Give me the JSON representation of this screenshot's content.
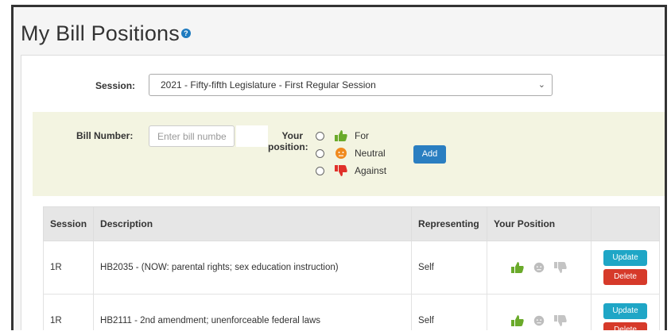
{
  "page": {
    "title": "My Bill Positions",
    "help_icon": "question-icon"
  },
  "session": {
    "label": "Session:",
    "selected": "2021 - Fifty-fifth Legislature - First Regular Session"
  },
  "add_form": {
    "bill_label": "Bill Number:",
    "bill_placeholder": "Enter bill numbe",
    "position_label_line1": "Your",
    "position_label_line2": "position:",
    "options": [
      {
        "label": "For",
        "icon": "thumbs-up-icon",
        "color": "#6aaa2a"
      },
      {
        "label": "Neutral",
        "icon": "neutral-face-icon",
        "color": "#f08a1e"
      },
      {
        "label": "Against",
        "icon": "thumbs-down-icon",
        "color": "#e0302a"
      }
    ],
    "add_label": "Add"
  },
  "table": {
    "headers": [
      "Session",
      "Description",
      "Representing",
      "Your Position",
      ""
    ],
    "rows": [
      {
        "session": "1R",
        "description": "HB2035 - (NOW: parental rights; sex education instruction)",
        "representing": "Self",
        "position": "For",
        "update": "Update",
        "delete": "Delete"
      },
      {
        "session": "1R",
        "description": "HB2111 - 2nd amendment; unenforceable federal laws",
        "representing": "Self",
        "position": "For",
        "update": "Update",
        "delete": "Delete"
      }
    ]
  },
  "colors": {
    "accent": "#2a7ec1",
    "update": "#1fa6c6",
    "delete": "#d63a2a",
    "form_bg": "#f3f4e1"
  }
}
